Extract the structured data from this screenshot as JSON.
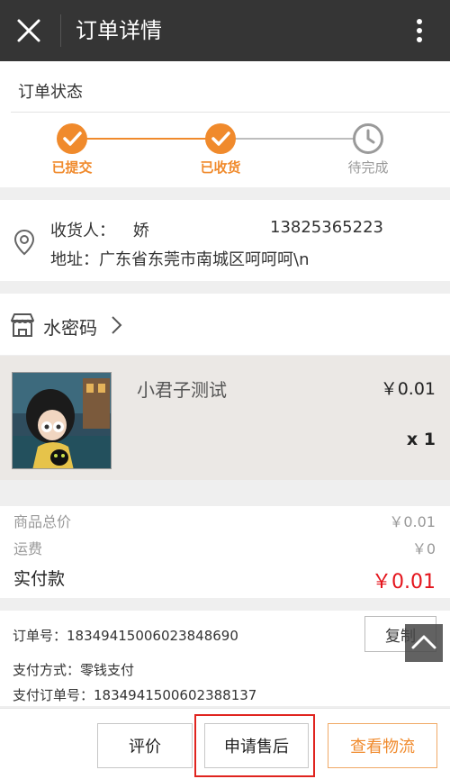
{
  "header": {
    "title": "订单详情"
  },
  "order_status": {
    "label": "订单状态",
    "steps": [
      {
        "label": "已提交",
        "state": "done"
      },
      {
        "label": "已收货",
        "state": "done"
      },
      {
        "label": "待完成",
        "state": "pending"
      }
    ]
  },
  "address": {
    "recipient_label": "收货人：",
    "recipient_name": "娇",
    "phone": "13825365223",
    "address_line": "地址：广东省东莞市南城区呵呵呵\\n"
  },
  "shop": {
    "name": "水密码"
  },
  "goods": {
    "name": "小君子测试",
    "price": "￥0.01",
    "qty": "x 1"
  },
  "totals": {
    "subtotal_label": "商品总价",
    "subtotal": "￥0.01",
    "shipping_label": "运费",
    "shipping": "￥0",
    "paid_label": "实付款",
    "paid": "￥0.01"
  },
  "order_info": {
    "order_no": "订单号：1834941500602384869​0",
    "copy_label": "复制",
    "pay_method": "支付方式：零钱支付",
    "pay_order_no": "支付订单号：1834941500602388137"
  },
  "actions": {
    "review": "评价",
    "after_sales": "申请售后",
    "logistics": "查看物流"
  },
  "colors": {
    "accent": "#f08a2c",
    "price_red": "#e4141c",
    "topbar": "#353535",
    "highlight": "#e0241f"
  },
  "icons": [
    "close-icon",
    "more-vertical-icon",
    "check-icon",
    "clock-icon",
    "location-pin-icon",
    "shop-icon",
    "chevron-right-icon",
    "back-to-top-icon"
  ]
}
